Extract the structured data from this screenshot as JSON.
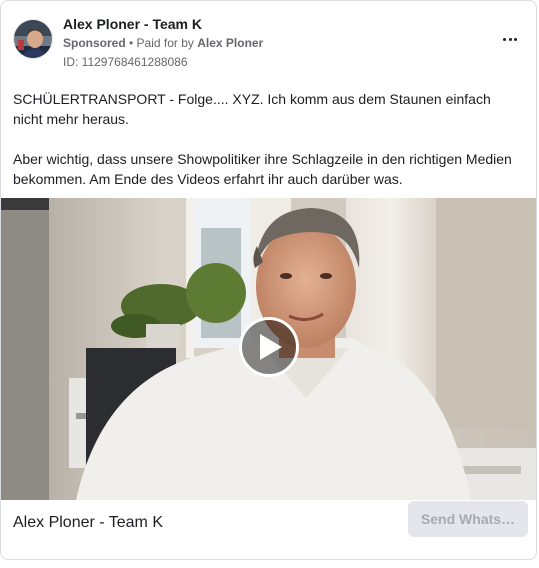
{
  "ad": {
    "page_name": "Alex Ploner - Team K",
    "sponsored_label": "Sponsored",
    "separator": " • ",
    "paid_for_by_prefix": "Paid for by ",
    "paid_for_by_name": "Alex Ploner",
    "ad_id": "ID: 1129768461288086",
    "body_paragraphs": [
      "SCHÜLERTRANSPORT - Folge.... XYZ. Ich komm aus dem Staunen einfach nicht mehr heraus.",
      "Aber wichtig, dass unsere Showpolitiker ihre Schlagzeile in den richtigen Medien bekommen. Am Ende des Videos erfahrt ihr auch darüber was."
    ],
    "footer_title": "Alex Ploner - Team K",
    "cta_label": "Send Whats…"
  },
  "icons": {
    "more": "more-horizontal-icon",
    "play": "play-icon",
    "avatar": "profile-photo"
  },
  "colors": {
    "text_primary": "#1c1e21",
    "text_secondary": "#65676b",
    "border": "#dadde1",
    "button_bg": "#e4e6eb",
    "button_text_disabled": "#a8aaae"
  }
}
